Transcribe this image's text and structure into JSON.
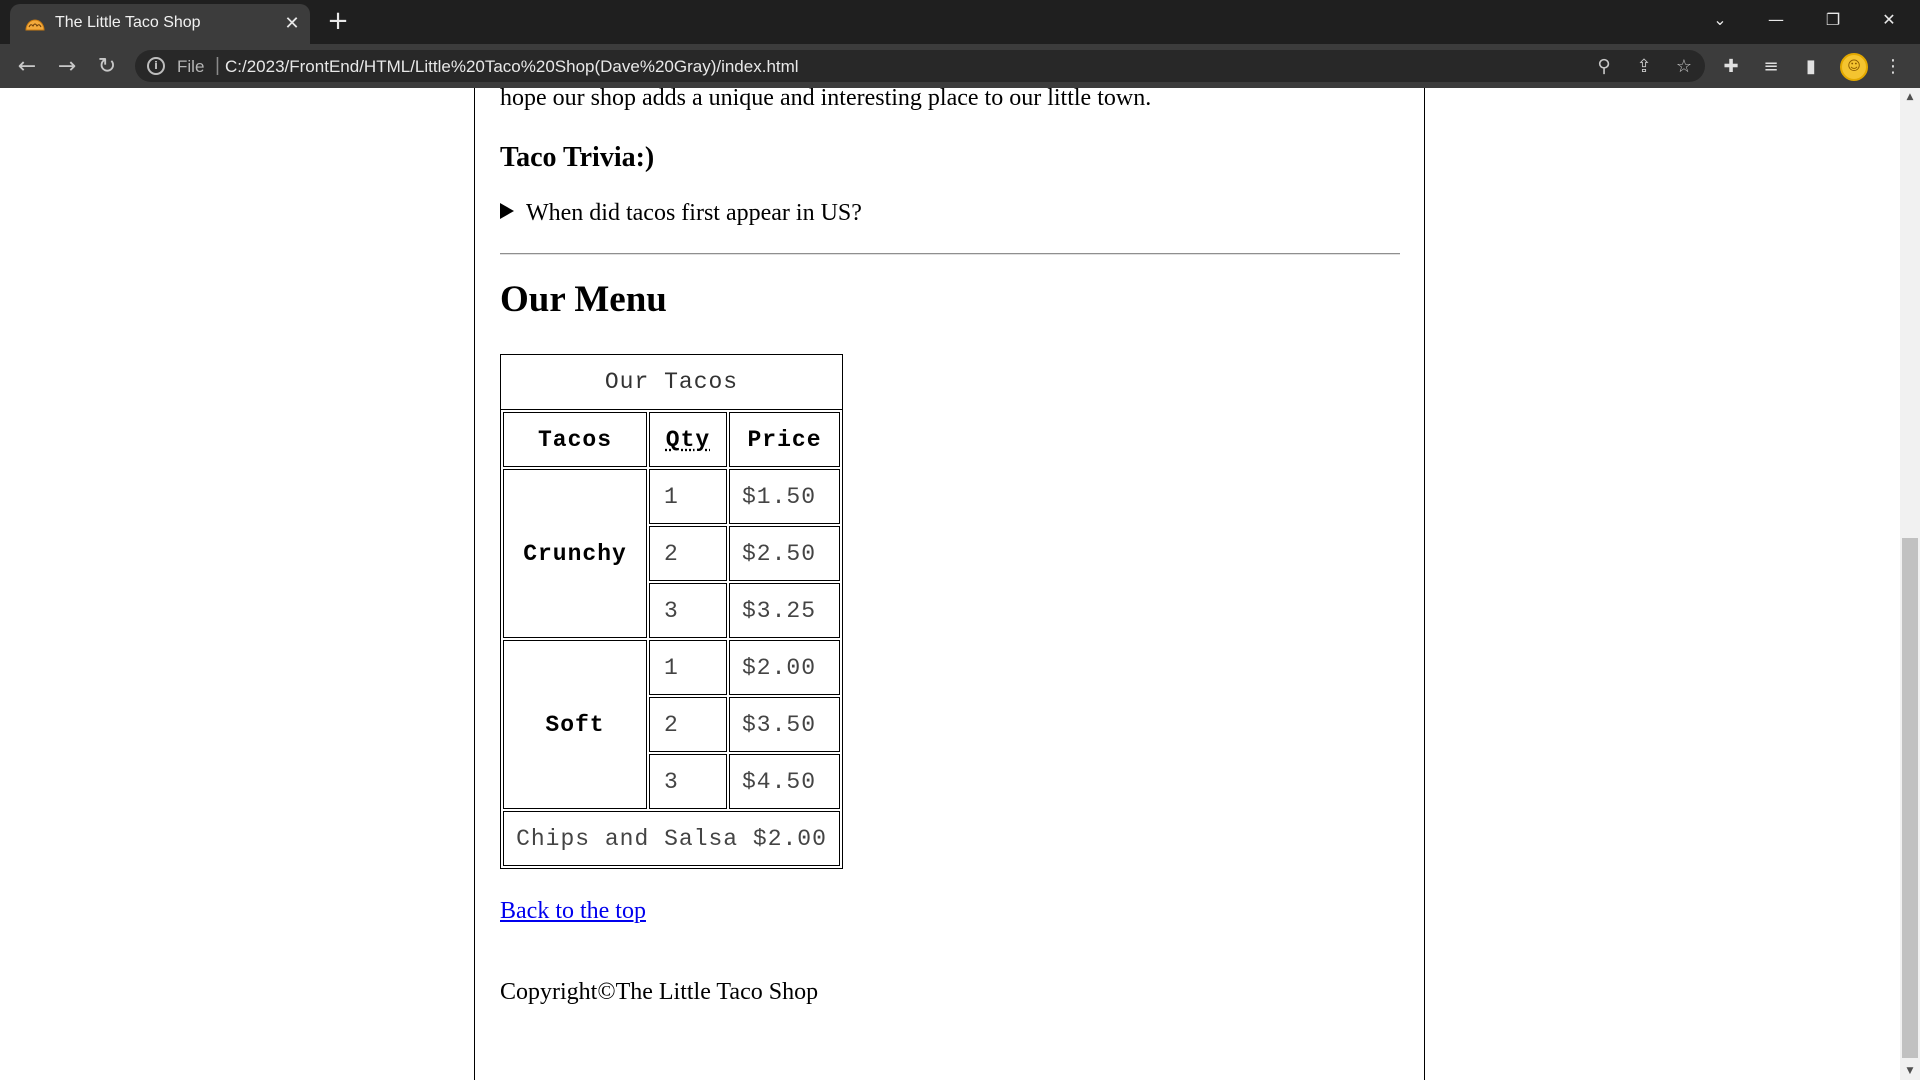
{
  "browser": {
    "tab_title": "The Little Taco Shop",
    "tab_close_glyph": "✕",
    "new_tab_glyph": "+",
    "url_scheme_label": "File",
    "url_separator": "|",
    "url": "C:/2023/FrontEnd/HTML/Little%20Taco%20Shop(Dave%20Gray)/index.html",
    "icons": [
      "back-icon",
      "forward-icon",
      "reload-icon",
      "info-icon",
      "zoom-icon",
      "share-icon",
      "bookmark-star-icon",
      "extensions-icon",
      "reading-list-icon",
      "side-panel-icon",
      "profile-avatar",
      "more-menu-icon",
      "tab-search-icon",
      "minimize-icon",
      "restore-icon",
      "close-window-icon"
    ]
  },
  "page": {
    "intro_tail": "hope our shop adds a unique and interesting place to our little town.",
    "trivia_heading": "Taco Trivia:)",
    "trivia_question": "When did tacos first appear in US?",
    "menu_heading": "Our Menu",
    "table": {
      "caption": "Our Tacos",
      "headers": {
        "tacos": "Tacos",
        "qty": "Qty",
        "price": "Price"
      },
      "groups": [
        {
          "type": "Crunchy",
          "rows": [
            {
              "qty": "1",
              "price": "$1.50"
            },
            {
              "qty": "2",
              "price": "$2.50"
            },
            {
              "qty": "3",
              "price": "$3.25"
            }
          ]
        },
        {
          "type": "Soft",
          "rows": [
            {
              "qty": "1",
              "price": "$2.00"
            },
            {
              "qty": "2",
              "price": "$3.50"
            },
            {
              "qty": "3",
              "price": "$4.50"
            }
          ]
        }
      ],
      "footer": "Chips and Salsa $2.00"
    },
    "back_to_top": "Back to the top",
    "copyright": "Copyright©The Little Taco Shop"
  },
  "colors": {
    "chrome_dark": "#1f1f1f",
    "chrome_toolbar": "#3c3c3c",
    "link": "#0000ee",
    "profile": "#f4c430"
  }
}
